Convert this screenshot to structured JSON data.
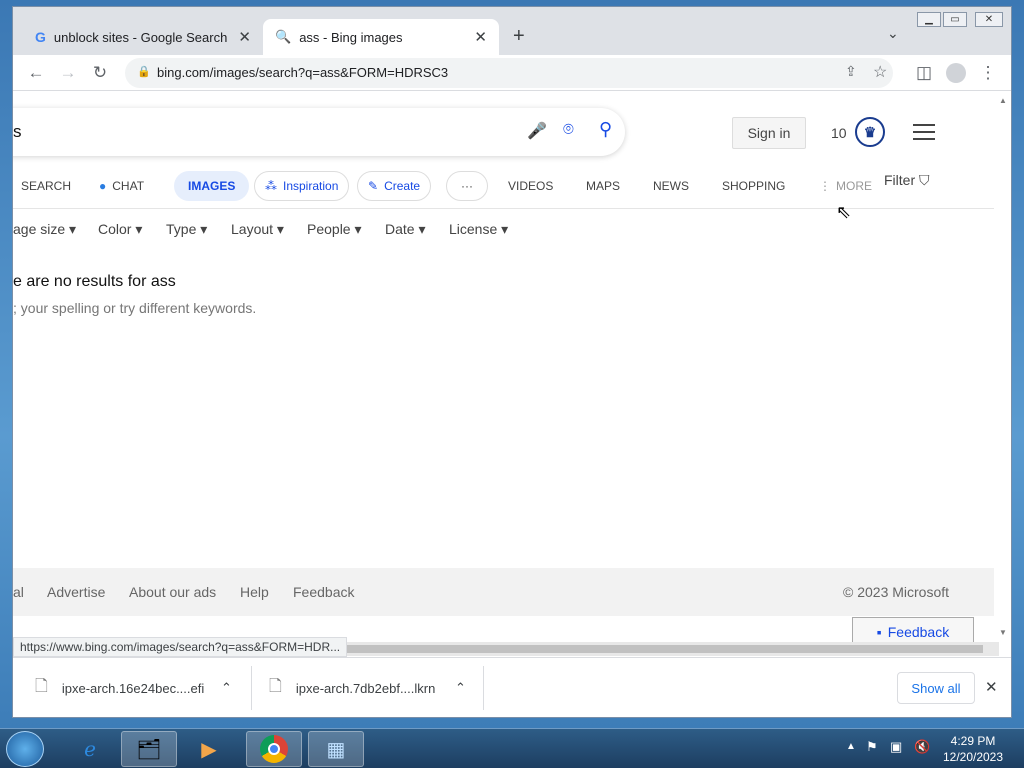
{
  "browser": {
    "tabs": [
      {
        "title": "unblock sites - Google Search",
        "icon": "google-g-icon"
      },
      {
        "title": "ass - Bing images",
        "icon": "search-icon"
      }
    ],
    "url": "bing.com/images/search?q=ass&FORM=HDRSC3"
  },
  "bing": {
    "query": "s",
    "sign_in": "Sign in",
    "rewards": "10",
    "nav": {
      "search": "SEARCH",
      "chat": "CHAT",
      "images": "IMAGES",
      "inspiration": "Inspiration",
      "create": "Create",
      "more_dots": "···",
      "videos": "VIDEOS",
      "maps": "MAPS",
      "news": "NEWS",
      "shopping": "SHOPPING",
      "more": "MORE"
    },
    "filter": "Filter",
    "filters": [
      "age size",
      "Color",
      "Type",
      "Layout",
      "People",
      "Date",
      "License"
    ],
    "no_results": "e are no results for ass",
    "suggestion": "; your spelling or try different keywords.",
    "footer": {
      "privacy": "al",
      "advertise": "Advertise",
      "about_ads": "About our ads",
      "help": "Help",
      "feedback": "Feedback",
      "copyright": "© 2023 Microsoft"
    },
    "feedback_button": "Feedback"
  },
  "status_url": "https://www.bing.com/images/search?q=ass&FORM=HDR...",
  "downloads": {
    "items": [
      "ipxe-arch.16e24bec....efi",
      "ipxe-arch.7db2ebf....lkrn"
    ],
    "show_all": "Show all"
  },
  "taskbar": {
    "time": "4:29 PM",
    "date": "12/20/2023"
  }
}
